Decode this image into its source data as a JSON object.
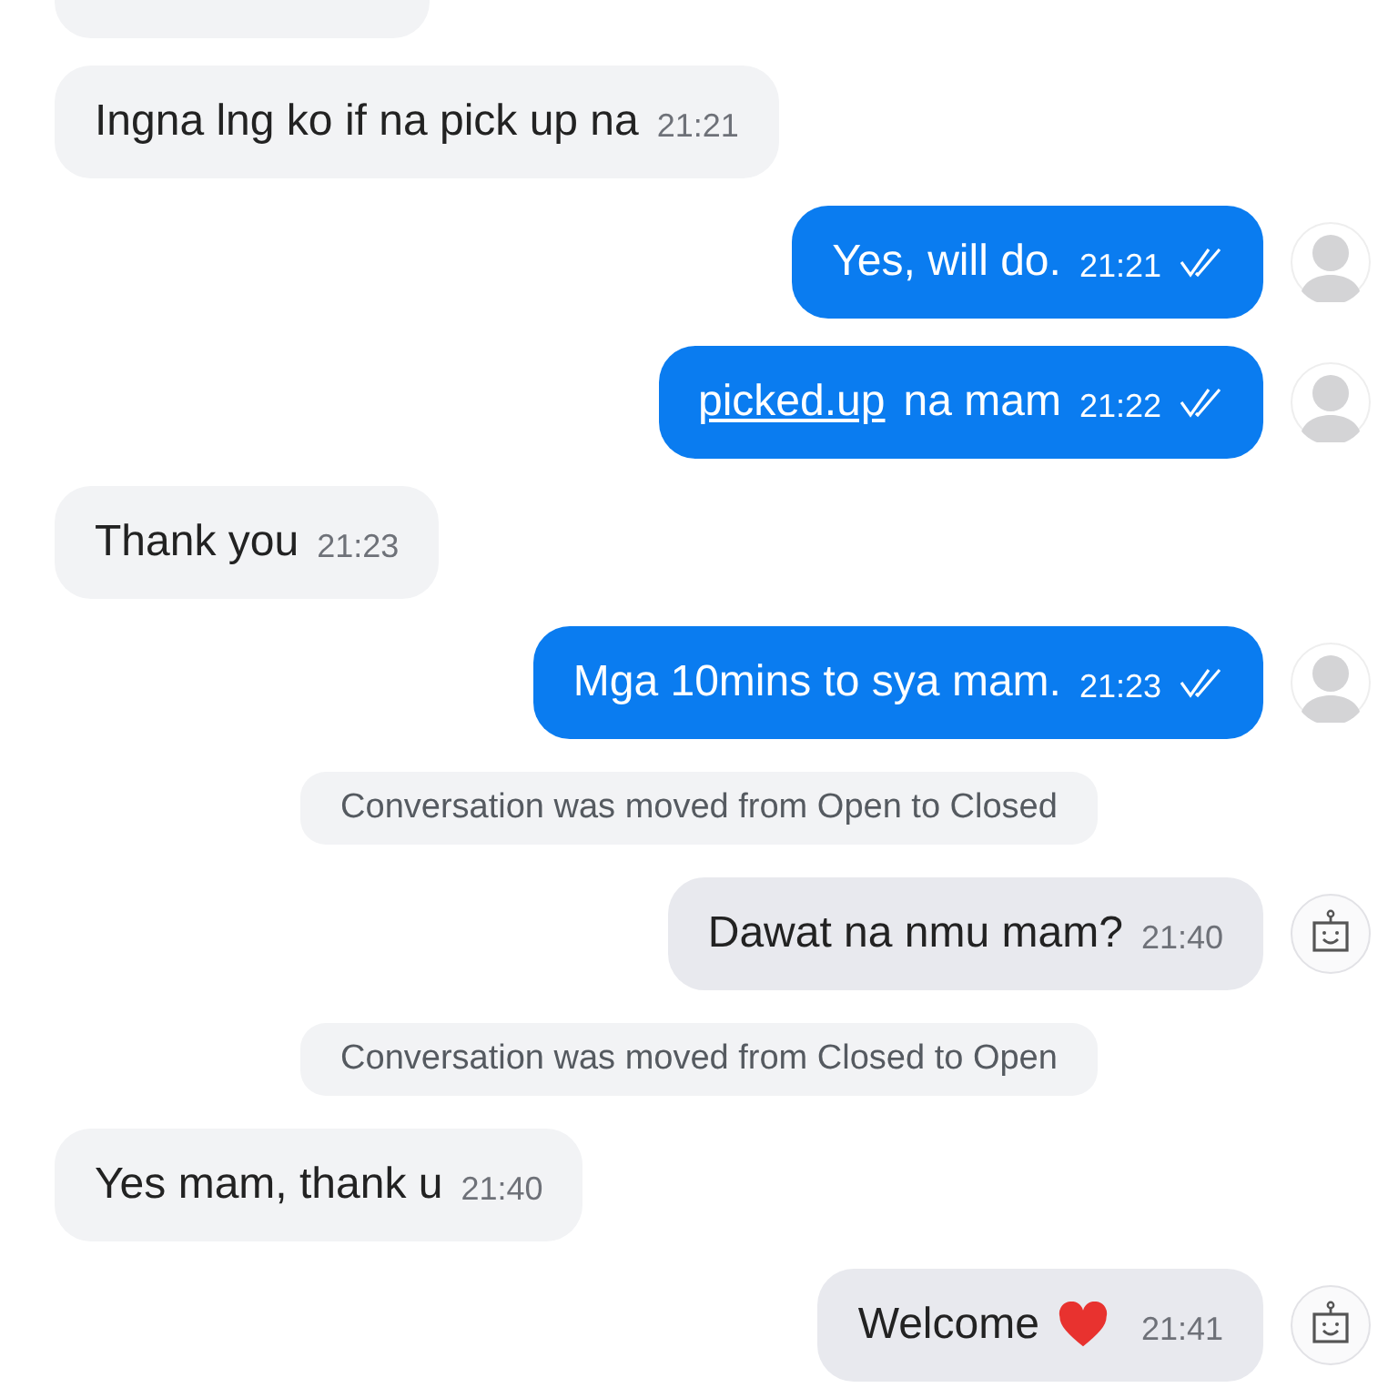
{
  "messages": [
    {
      "kind": "incoming",
      "cut": true
    },
    {
      "kind": "incoming",
      "text": "Ingna lng ko if na pick up na",
      "time": "21:21"
    },
    {
      "kind": "outgoing",
      "text": "Yes, will do.",
      "time": "21:21",
      "read": true
    },
    {
      "kind": "outgoing",
      "link": "picked.up",
      "text": "na mam",
      "time": "21:22",
      "read": true
    },
    {
      "kind": "incoming",
      "text": "Thank you",
      "time": "21:23"
    },
    {
      "kind": "outgoing",
      "text": "Mga 10mins to sya mam.",
      "time": "21:23",
      "read": true
    },
    {
      "kind": "system",
      "text": "Conversation was moved from Open to Closed"
    },
    {
      "kind": "bot",
      "text": "Dawat na nmu mam?",
      "time": "21:40"
    },
    {
      "kind": "system",
      "text": "Conversation was moved from Closed to Open"
    },
    {
      "kind": "incoming",
      "text": "Yes mam, thank u",
      "time": "21:40"
    },
    {
      "kind": "bot",
      "text": "Welcome",
      "heart": true,
      "time": "21:41"
    }
  ]
}
